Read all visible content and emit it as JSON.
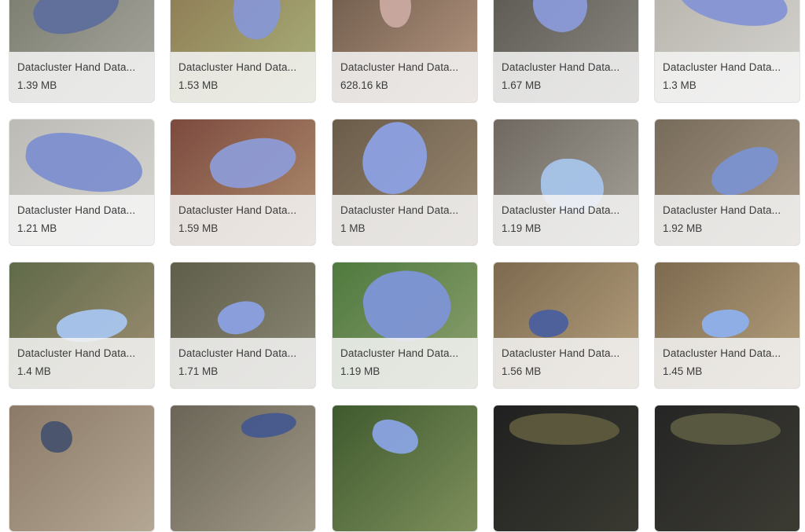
{
  "gallery": {
    "items": [
      {
        "name": "Datacluster Hand Data...",
        "size": "1.39 MB",
        "bg": [
          "#7a7c6e",
          "#a9a8a1"
        ],
        "glove_color": "#5f6f9c",
        "image_icon": "gloved-hand-image"
      },
      {
        "name": "Datacluster Hand Data...",
        "size": "1.53 MB",
        "bg": [
          "#8e7a54",
          "#a9b27a"
        ],
        "glove_color": "#8797d3",
        "image_icon": "gloved-hand-image"
      },
      {
        "name": "Datacluster Hand Data...",
        "size": "628.16 kB",
        "bg": [
          "#6e5a4a",
          "#b89a84"
        ],
        "glove_color": "#c9a9a0",
        "image_icon": "bracelet-wrist-image"
      },
      {
        "name": "Datacluster Hand Data...",
        "size": "1.67 MB",
        "bg": [
          "#5b5852",
          "#8d8a84"
        ],
        "glove_color": "#8a9ad8",
        "image_icon": "gloved-hand-image"
      },
      {
        "name": "Datacluster Hand Data...",
        "size": "1.3 MB",
        "bg": [
          "#b7b4ad",
          "#d6d4cf"
        ],
        "glove_color": "#8594d5",
        "image_icon": "gloved-hand-image"
      },
      {
        "name": "Datacluster Hand Data...",
        "size": "1.21 MB",
        "bg": [
          "#bcbbb6",
          "#d7d6d1"
        ],
        "glove_color": "#7d8fcf",
        "image_icon": "gloved-hand-image"
      },
      {
        "name": "Datacluster Hand Data...",
        "size": "1.59 MB",
        "bg": [
          "#7c4a3e",
          "#b08e70"
        ],
        "glove_color": "#8d9bd6",
        "image_icon": "gloved-hand-remote-image"
      },
      {
        "name": "Datacluster Hand Data...",
        "size": "1 MB",
        "bg": [
          "#6a5c4a",
          "#9b8a72"
        ],
        "glove_color": "#8ca0e2",
        "image_icon": "gloved-hand-image"
      },
      {
        "name": "Datacluster Hand Data...",
        "size": "1.19 MB",
        "bg": [
          "#6e6860",
          "#a7a39b"
        ],
        "glove_color": "#a7c4ea",
        "image_icon": "hand-image"
      },
      {
        "name": "Datacluster Hand Data...",
        "size": "1.92 MB",
        "bg": [
          "#776b5b",
          "#a99a86"
        ],
        "glove_color": "#7b92d0",
        "image_icon": "gloved-hand-image"
      },
      {
        "name": "Datacluster Hand Data...",
        "size": "1.4 MB",
        "bg": [
          "#5f6a48",
          "#9f8f74"
        ],
        "glove_color": "#a8c5ee",
        "image_icon": "gloved-hand-image"
      },
      {
        "name": "Datacluster Hand Data...",
        "size": "1.71 MB",
        "bg": [
          "#5f5e4a",
          "#8d8a78"
        ],
        "glove_color": "#8aa0e0",
        "image_icon": "gloved-hand-image"
      },
      {
        "name": "Datacluster Hand Data...",
        "size": "1.19 MB",
        "bg": [
          "#4f7a3e",
          "#8ea070"
        ],
        "glove_color": "#7d95d6",
        "image_icon": "gloved-hand-image"
      },
      {
        "name": "Datacluster Hand Data...",
        "size": "1.56 MB",
        "bg": [
          "#7d6a4f",
          "#b6a27f"
        ],
        "glove_color": "#4a5f9e",
        "image_icon": "gloved-hand-image"
      },
      {
        "name": "Datacluster Hand Data...",
        "size": "1.45 MB",
        "bg": [
          "#7d6a4f",
          "#b6a27f"
        ],
        "glove_color": "#8eb0ec",
        "image_icon": "gloved-hand-image"
      },
      {
        "name": "",
        "size": "",
        "bg": [
          "#8b7a67",
          "#b4a793"
        ],
        "glove_color": "#47536e",
        "image_icon": "gloved-hand-image"
      },
      {
        "name": "",
        "size": "",
        "bg": [
          "#6b6557",
          "#a09988"
        ],
        "glove_color": "#46598e",
        "image_icon": "gloved-hand-image"
      },
      {
        "name": "",
        "size": "",
        "bg": [
          "#3f5a2e",
          "#7e8f5c"
        ],
        "glove_color": "#8aa3e2",
        "image_icon": "gloved-hand-image"
      },
      {
        "name": "",
        "size": "",
        "bg": [
          "#202020",
          "#3a3a32"
        ],
        "glove_color": "#5d5a3e",
        "image_icon": "dark-image"
      },
      {
        "name": "",
        "size": "",
        "bg": [
          "#252525",
          "#3c3b33"
        ],
        "glove_color": "#5b5a40",
        "image_icon": "dark-image"
      }
    ]
  }
}
